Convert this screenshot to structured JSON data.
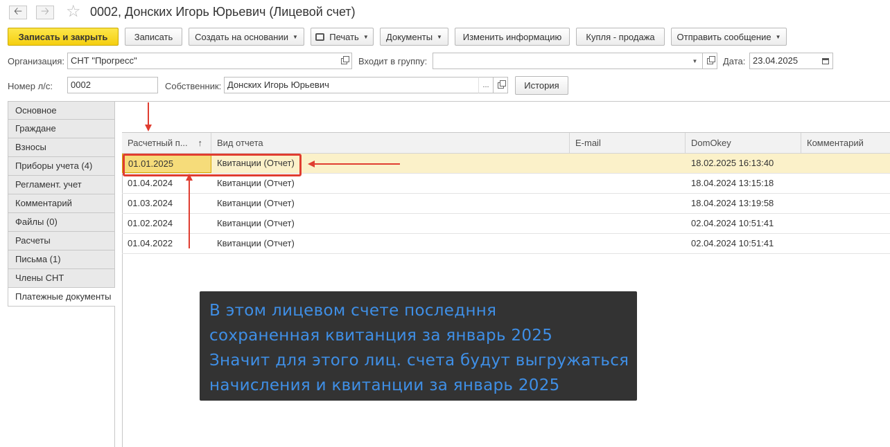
{
  "window": {
    "title": "0002, Донских Игорь Юрьевич (Лицевой счет)",
    "back_icon": "arrow-left-icon",
    "forward_icon": "arrow-right-icon",
    "favorite_icon": "star-icon"
  },
  "toolbar": {
    "save_close": "Записать и закрыть",
    "save": "Записать",
    "create_based": "Создать на основании",
    "print": "Печать",
    "documents": "Документы",
    "change_info": "Изменить информацию",
    "buy_sell": "Купля - продажа",
    "send_message": "Отправить сообщение"
  },
  "form": {
    "organization_label": "Организация:",
    "organization_value": "СНТ \"Прогресс\"",
    "group_label": "Входит в группу:",
    "group_value": "",
    "date_label": "Дата:",
    "date_value": "23.04.2025",
    "account_label": "Номер л/с:",
    "account_value": "0002",
    "owner_label": "Собственник:",
    "owner_value": "Донских Игорь Юрьевич",
    "owner_select": "...",
    "history_button": "История"
  },
  "tabs": [
    {
      "label": "Основное"
    },
    {
      "label": "Граждане"
    },
    {
      "label": "Взносы"
    },
    {
      "label": "Приборы учета (4)"
    },
    {
      "label": "Регламент. учет"
    },
    {
      "label": "Комментарий"
    },
    {
      "label": "Файлы (0)"
    },
    {
      "label": "Расчеты"
    },
    {
      "label": "Письма (1)"
    },
    {
      "label": "Члены СНТ"
    },
    {
      "label": "Платежные документы",
      "active": true
    }
  ],
  "grid": {
    "columns": [
      "Расчетный п...",
      "Вид отчета",
      "E-mail",
      "DomOkey",
      "Комментарий"
    ],
    "sort_icon": "sort-ascending-icon",
    "rows": [
      [
        "01.01.2025",
        "Квитанции (Отчет)",
        "",
        "18.02.2025 16:13:40",
        ""
      ],
      [
        "01.04.2024",
        "Квитанции (Отчет)",
        "",
        "18.04.2024 13:15:18",
        ""
      ],
      [
        "01.03.2024",
        "Квитанции (Отчет)",
        "",
        "18.04.2024 13:19:58",
        ""
      ],
      [
        "01.02.2024",
        "Квитанции (Отчет)",
        "",
        "02.04.2024 10:51:41",
        ""
      ],
      [
        "01.04.2022",
        "Квитанции (Отчет)",
        "",
        "02.04.2024 10:51:41",
        ""
      ]
    ]
  },
  "annotation": {
    "lines": [
      "В этом лицевом счете последння",
      "сохраненная квитанция за январь 2025",
      "Значит для этого лиц. счета будут выгружаться",
      "начисления и квитанции за январь 2025"
    ],
    "arrow_color": "#e03d30",
    "text_color": "#3f8fe6",
    "box_color": "#333333"
  }
}
